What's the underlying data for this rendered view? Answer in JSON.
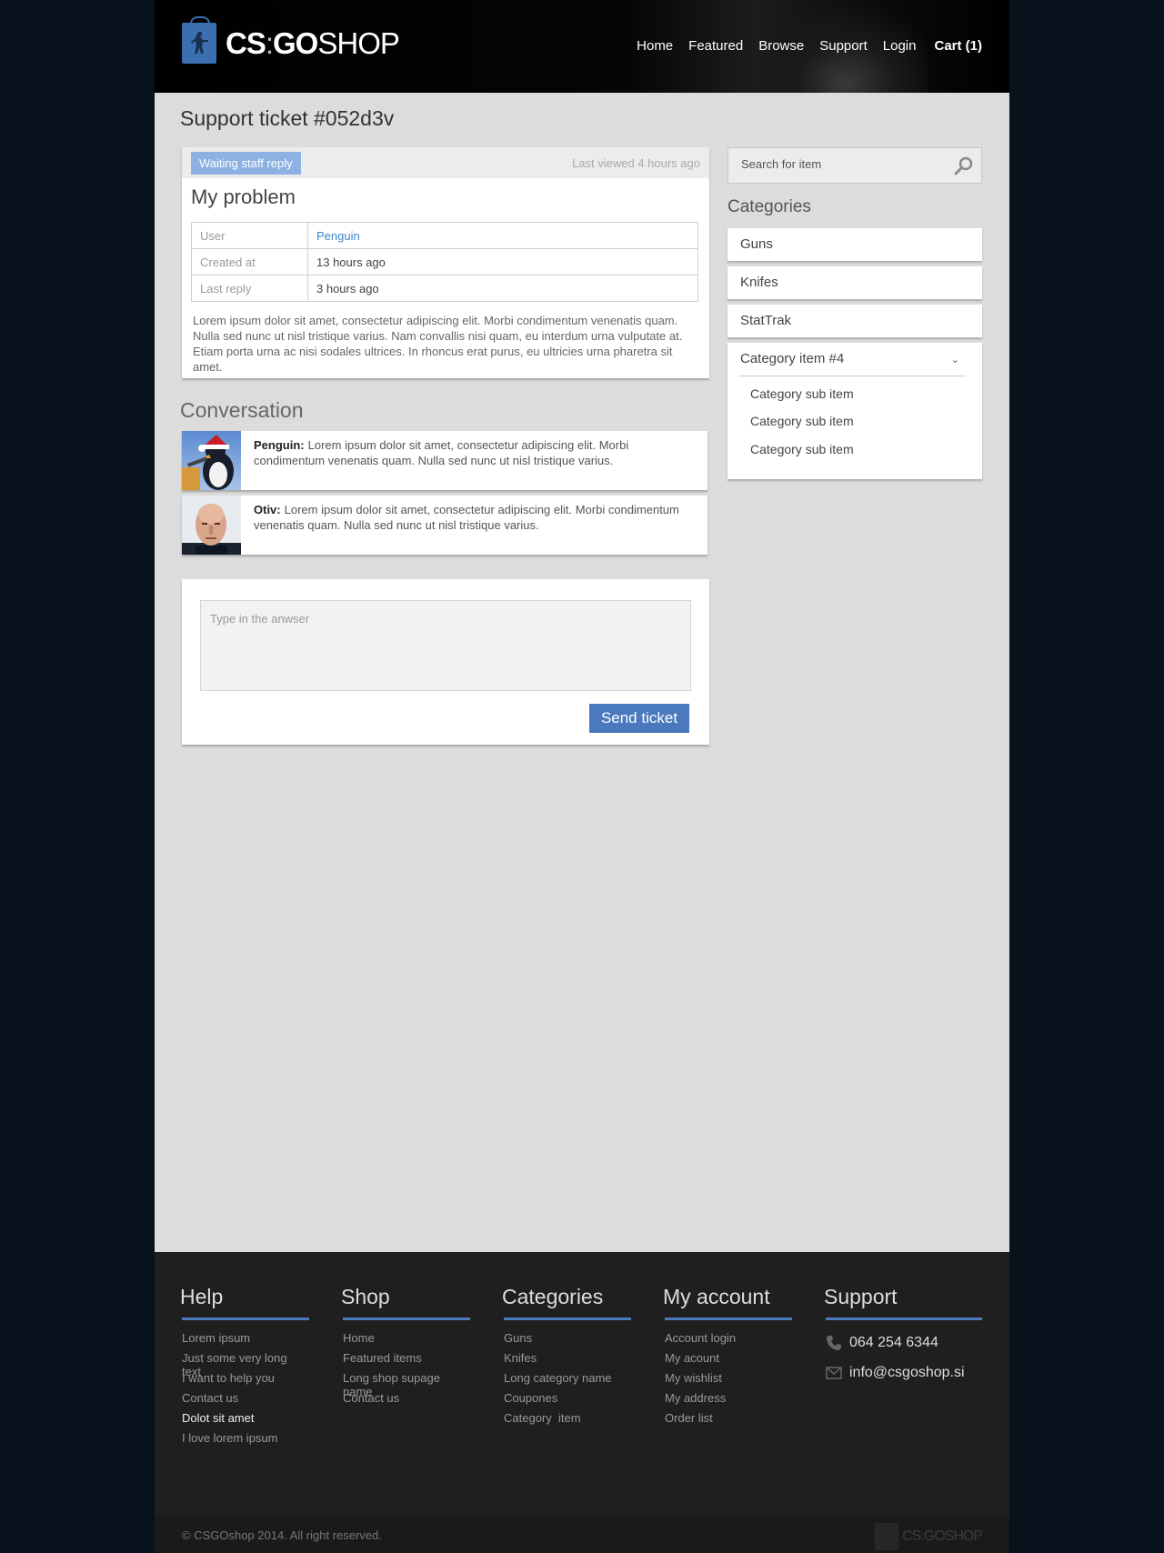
{
  "brand": {
    "cs": "CS",
    "colon": ":",
    "go": "GO",
    "shop": "SHOP"
  },
  "nav": {
    "home": "Home",
    "featured": "Featured",
    "browse": "Browse",
    "support": "Support",
    "login": "Login",
    "cart": "Cart (1)"
  },
  "page_title": "Support ticket #052d3v",
  "ticket": {
    "status": "Waiting staff reply",
    "last_viewed": "Last viewed 4 hours ago",
    "title": "My problem",
    "rows": [
      {
        "key": "User",
        "value": "Penguin"
      },
      {
        "key": "Created at",
        "value": "13 hours ago"
      },
      {
        "key": "Last reply",
        "value": "3 hours ago"
      }
    ],
    "body": "Lorem ipsum dolor sit amet, consectetur adipiscing elit. Morbi condimentum venenatis quam. Nulla sed nunc ut nisl tristique varius. Nam convallis nisi quam, eu interdum urna vulputate at. Etiam porta urna ac nisi sodales ultrices. In rhoncus erat purus, eu ultricies urna pharetra sit amet."
  },
  "conversation": {
    "title": "Conversation",
    "messages": [
      {
        "author": "Penguin:",
        "text": "Lorem ipsum dolor sit amet, consectetur adipiscing elit. Morbi condimentum venenatis quam. Nulla sed nunc ut nisl tristique varius."
      },
      {
        "author": "Otiv:",
        "text": "Lorem ipsum dolor sit amet, consectetur adipiscing elit. Morbi condimentum venenatis quam. Nulla sed nunc ut nisl tristique varius."
      }
    ]
  },
  "reply": {
    "placeholder": "Type in the anwser",
    "send": "Send ticket"
  },
  "sidebar": {
    "search_placeholder": "Search for item",
    "categories_title": "Categories",
    "items": [
      "Guns",
      "Knifes",
      "StatTrak"
    ],
    "open_item": "Category item #4",
    "sub_items": [
      "Category sub item",
      "Category sub item",
      "Category sub item"
    ]
  },
  "footer": {
    "help": {
      "title": "Help",
      "links": [
        "Lorem ipsum",
        "Just some very long text",
        "I want to help you",
        "Contact us",
        "Dolot sit amet",
        "I love lorem ipsum"
      ]
    },
    "shop": {
      "title": "Shop",
      "links": [
        "Home",
        "Featured items",
        "Long shop supage name",
        "Contact us"
      ]
    },
    "categories": {
      "title": "Categories",
      "links": [
        "Guns",
        "Knifes",
        "Long category name",
        "Coupones",
        "Category  item"
      ]
    },
    "account": {
      "title": "My account",
      "links": [
        "Account login",
        "My acount",
        "My wishlist",
        "My address",
        "Order list"
      ]
    },
    "support": {
      "title": "Support",
      "phone": "064 254 6344",
      "email": "info@csgoshop.si"
    },
    "copyright": "© CSGOshop 2014. All right reserved.",
    "mini_logo": "CS:GOSHOP"
  },
  "colors": {
    "accent": "#4a79be",
    "badge": "#8db1e3",
    "link": "#3a86c8",
    "footer_bg": "#1f1f1f"
  }
}
